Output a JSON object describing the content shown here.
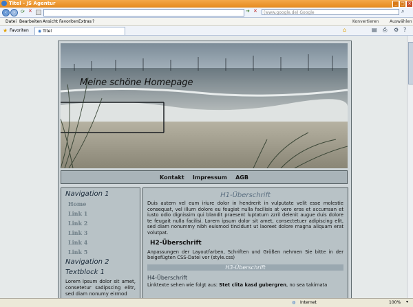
{
  "window": {
    "title": "Titel - JS Agentur"
  },
  "browser": {
    "search_placeholder": "(www.google.de) Google",
    "menu": [
      "Datei",
      "Bearbeiten",
      "Ansicht",
      "Favoriten",
      "Extras",
      "?"
    ],
    "toolbar_right": {
      "convert": "Konvertieren",
      "select": "Auswählen"
    },
    "favorites_label": "Favoriten",
    "tab_title": "Titel",
    "status": {
      "zone": "Internet",
      "zoom": "100%"
    }
  },
  "site": {
    "title": "Meine schöne Homepage",
    "nav": [
      "Kontakt",
      "Impressum",
      "AGB"
    ],
    "sidebar": {
      "nav1_title": "Navigation 1",
      "links": [
        "Home",
        "Link 1",
        "Link 2",
        "Link 3",
        "Link 4",
        "Link 5"
      ],
      "nav2_title": "Navigation 2",
      "textblock_title": "Textblock 1",
      "textblock_text": "Lorem ipsum dolor sit amet, consetetur sadipscing elitr, sed diam nonumy eirmod"
    },
    "main": {
      "h1": "H1-Überschrift",
      "p1": "Duis autem vel eum iriure dolor in hendrerit in vulputate velit esse molestie consequat, vel illum dolore eu feugiat nulla facilisis at vero eros et accumsan et iusto odio dignissim qui blandit praesent luptatum zzril delenit augue duis dolore te feugait nulla facilisi. Lorem ipsum dolor sit amet, consectetuer adipiscing elit, sed diam nonummy nibh euismod tincidunt ut laoreet dolore magna aliquam erat volutpat.",
      "h2": "H2-Überschrift",
      "p2": "Anpassungen der Layoutfarben, Schriften und Größen nehmen Sie bitte in der beigefügten CSS-Datei vor (style.css)",
      "h3": "H3-Überschrift",
      "h4": "H4-Überschrift",
      "p3_start": "Linktexte sehen wie folgt aus: ",
      "p3_bold": "Stet clita kasd gubergren",
      "p3_end": ", no sea takimata"
    }
  }
}
